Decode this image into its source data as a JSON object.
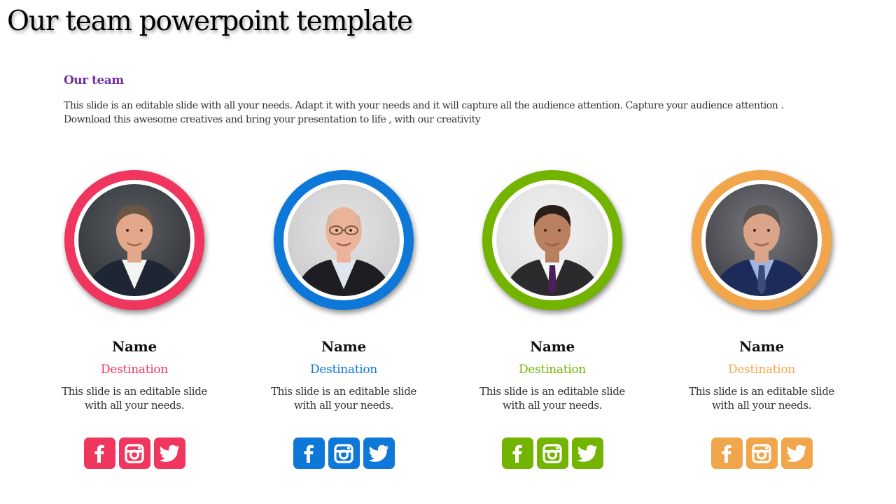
{
  "slide": {
    "title": "Our team powerpoint template",
    "heading": "Our team",
    "heading_color": "#7030a0",
    "intro_lines": [
      "This slide is an editable slide with all your needs. Adapt it with your needs and it will capture all the audience attention. Capture your audience attention .",
      "Download this awesome creatives and bring your presentation to life , with our creativity"
    ]
  },
  "members": [
    {
      "name": "Name",
      "role": "Destination",
      "desc_lines": [
        "This slide is an editable slide",
        "with all your needs."
      ],
      "accent": "#f0355e",
      "photo": "man-smiling-dark-suit-white-shirt",
      "social": [
        "facebook-icon",
        "instagram-icon",
        "twitter-icon"
      ]
    },
    {
      "name": "Name",
      "role": "Destination",
      "desc_lines": [
        "This slide is an editable slide",
        "with all your needs."
      ],
      "accent": "#0e78d8",
      "photo": "bald-man-glasses",
      "social": [
        "facebook-icon",
        "instagram-icon",
        "twitter-icon"
      ]
    },
    {
      "name": "Name",
      "role": "Destination",
      "desc_lines": [
        "This slide is an editable slide",
        "with all your needs."
      ],
      "accent": "#72b400",
      "photo": "man-grey-suit-purple-tie",
      "social": [
        "facebook-icon",
        "instagram-icon",
        "twitter-icon"
      ]
    },
    {
      "name": "Name",
      "role": "Destination",
      "desc_lines": [
        "This slide is an editable slide",
        "with all your needs."
      ],
      "accent": "#f2a64c",
      "photo": "man-navy-suit-striped-tie",
      "social": [
        "facebook-icon",
        "instagram-icon",
        "twitter-icon"
      ]
    }
  ]
}
